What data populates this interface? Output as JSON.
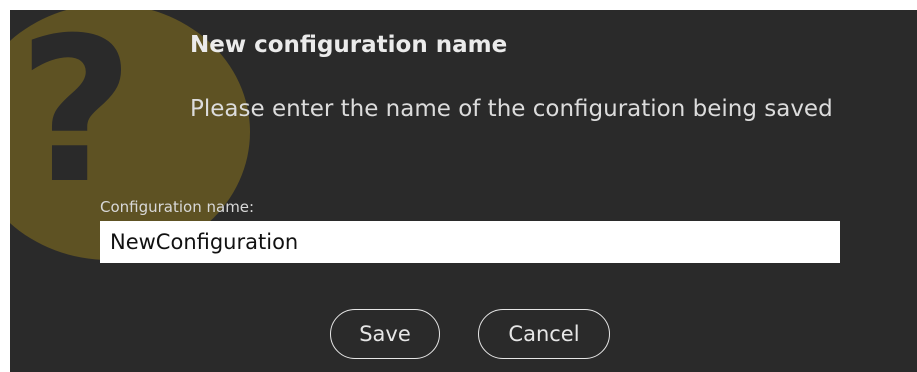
{
  "dialog": {
    "title": "New configuration name",
    "message": "Please enter the name of the configuration being saved",
    "icon": "question-mark-icon",
    "field_label": "Configuration name:",
    "field_value": "NewConfiguration",
    "save_label": "Save",
    "cancel_label": "Cancel"
  },
  "colors": {
    "background": "#2a2a2a",
    "icon_circle": "#5e5223",
    "text": "#ebebeb",
    "input_background": "#ffffff"
  }
}
